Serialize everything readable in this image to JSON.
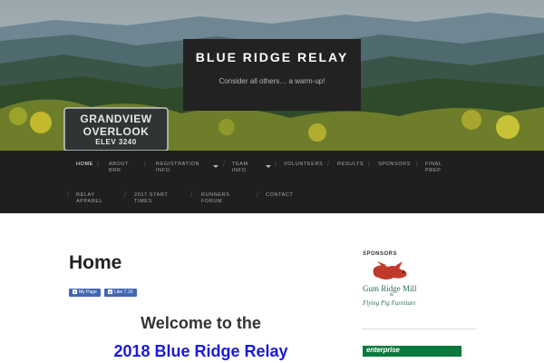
{
  "site": {
    "title": "BLUE RIDGE RELAY",
    "tagline": "Consider all others… a warm-up!"
  },
  "hero_sign": {
    "line1": "GRANDVIEW",
    "line2": "OVERLOOK",
    "line3": "ELEV 3240"
  },
  "nav": {
    "items": [
      {
        "label": "HOME",
        "active": true
      },
      {
        "label": "ABOUT BRR"
      },
      {
        "label": "REGISTRATION INFO",
        "has_dropdown": true
      },
      {
        "label": "TEAM INFO",
        "has_dropdown": true
      },
      {
        "label": "VOLUNTEERS"
      },
      {
        "label": "RESULTS"
      },
      {
        "label": "SPONSORS"
      },
      {
        "label": "FINAL PREP"
      },
      {
        "label": "RELAY APPAREL"
      },
      {
        "label": "2017 START TIMES"
      },
      {
        "label": "RUNNERS FORUM"
      },
      {
        "label": "CONTACT"
      }
    ]
  },
  "main": {
    "page_title": "Home",
    "fb_mypage": "My Page",
    "fb_like": "Like 7.1K",
    "welcome": "Welcome to the",
    "year_title": "2018 Blue Ridge Relay"
  },
  "sidebar": {
    "heading": "SPONSORS",
    "sponsor1_name": "Gum Ridge Mill",
    "sponsor1_amp": "&",
    "sponsor1_sub": "Flying Pig Furniture",
    "sponsor2_name": "enterprise"
  },
  "colors": {
    "nav_bg": "#1f1f1f",
    "title_box_bg": "#222222",
    "link_blue": "#1a1ad6",
    "facebook_blue": "#4267b2",
    "sponsor_green": "#2c6f52",
    "enterprise_green": "#0a7a3c"
  }
}
